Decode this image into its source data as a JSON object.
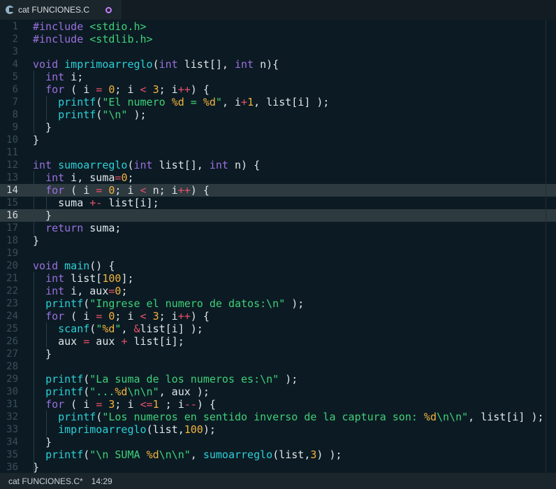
{
  "tab": {
    "title": "cat FUNCIONES.C",
    "icon": "c-file-icon",
    "dirty": true
  },
  "status": {
    "file": "cat FUNCIONES.C*",
    "position": "14:29"
  },
  "editor": {
    "highlight_lines": [
      14,
      16
    ],
    "lines": [
      [
        [
          "pp",
          "#include "
        ],
        [
          "st",
          "<stdio.h>"
        ]
      ],
      [
        [
          "pp",
          "#include "
        ],
        [
          "st",
          "<stdlib.h>"
        ]
      ],
      [],
      [
        [
          "ty",
          "void "
        ],
        [
          "fn",
          "imprimoarreglo"
        ],
        [
          "pl",
          "("
        ],
        [
          "ty",
          "int"
        ],
        [
          "pl",
          " list[], "
        ],
        [
          "ty",
          "int"
        ],
        [
          "pl",
          " n){"
        ]
      ],
      [
        [
          "pl",
          "  "
        ],
        [
          "ty",
          "int"
        ],
        [
          "pl",
          " i;"
        ]
      ],
      [
        [
          "pl",
          "  "
        ],
        [
          "kw",
          "for"
        ],
        [
          "pl",
          " ( i "
        ],
        [
          "op",
          "="
        ],
        [
          "pl",
          " "
        ],
        [
          "nu",
          "0"
        ],
        [
          "pl",
          "; i "
        ],
        [
          "op",
          "<"
        ],
        [
          "pl",
          " "
        ],
        [
          "nu",
          "3"
        ],
        [
          "pl",
          "; i"
        ],
        [
          "op",
          "++"
        ],
        [
          "pl",
          ") {"
        ]
      ],
      [
        [
          "pl",
          "    "
        ],
        [
          "fn",
          "printf"
        ],
        [
          "pl",
          "("
        ],
        [
          "st",
          "\"El numero "
        ],
        [
          "fm",
          "%d"
        ],
        [
          "st",
          " = "
        ],
        [
          "fm",
          "%d"
        ],
        [
          "st",
          "\""
        ],
        [
          "pl",
          ", i"
        ],
        [
          "op",
          "+"
        ],
        [
          "nu",
          "1"
        ],
        [
          "pl",
          ", list[i] );"
        ]
      ],
      [
        [
          "pl",
          "    "
        ],
        [
          "fn",
          "printf"
        ],
        [
          "pl",
          "("
        ],
        [
          "st",
          "\"\\n\""
        ],
        [
          "pl",
          " );"
        ]
      ],
      [
        [
          "pl",
          "  }"
        ]
      ],
      [
        [
          "pl",
          "}"
        ]
      ],
      [],
      [
        [
          "ty",
          "int "
        ],
        [
          "fn",
          "sumoarreglo"
        ],
        [
          "pl",
          "("
        ],
        [
          "ty",
          "int"
        ],
        [
          "pl",
          " list[], "
        ],
        [
          "ty",
          "int"
        ],
        [
          "pl",
          " n) {"
        ]
      ],
      [
        [
          "pl",
          "  "
        ],
        [
          "ty",
          "int"
        ],
        [
          "pl",
          " i, suma"
        ],
        [
          "op",
          "="
        ],
        [
          "nu",
          "0"
        ],
        [
          "pl",
          ";"
        ]
      ],
      [
        [
          "pl",
          "  "
        ],
        [
          "kw",
          "for"
        ],
        [
          "pl",
          " ( i "
        ],
        [
          "op",
          "="
        ],
        [
          "pl",
          " "
        ],
        [
          "nu",
          "0"
        ],
        [
          "pl",
          "; i "
        ],
        [
          "op",
          "<"
        ],
        [
          "pl",
          " n; i"
        ],
        [
          "op",
          "++"
        ],
        [
          "pl",
          ") {"
        ]
      ],
      [
        [
          "pl",
          "    suma "
        ],
        [
          "op",
          "+-"
        ],
        [
          "pl",
          " list[i];"
        ]
      ],
      [
        [
          "pl",
          "  }"
        ]
      ],
      [
        [
          "pl",
          "  "
        ],
        [
          "kw",
          "return"
        ],
        [
          "pl",
          " suma;"
        ]
      ],
      [
        [
          "pl",
          "}"
        ]
      ],
      [],
      [
        [
          "ty",
          "void "
        ],
        [
          "fn",
          "main"
        ],
        [
          "pl",
          "() {"
        ]
      ],
      [
        [
          "pl",
          "  "
        ],
        [
          "ty",
          "int"
        ],
        [
          "pl",
          " list["
        ],
        [
          "nu",
          "100"
        ],
        [
          "pl",
          "];"
        ]
      ],
      [
        [
          "pl",
          "  "
        ],
        [
          "ty",
          "int"
        ],
        [
          "pl",
          " i, aux"
        ],
        [
          "op",
          "="
        ],
        [
          "nu",
          "0"
        ],
        [
          "pl",
          ";"
        ]
      ],
      [
        [
          "pl",
          "  "
        ],
        [
          "fn",
          "printf"
        ],
        [
          "pl",
          "("
        ],
        [
          "st",
          "\"Ingrese el numero de datos:\\n\""
        ],
        [
          "pl",
          " );"
        ]
      ],
      [
        [
          "pl",
          "  "
        ],
        [
          "kw",
          "for"
        ],
        [
          "pl",
          " ( i "
        ],
        [
          "op",
          "="
        ],
        [
          "pl",
          " "
        ],
        [
          "nu",
          "0"
        ],
        [
          "pl",
          "; i "
        ],
        [
          "op",
          "<"
        ],
        [
          "pl",
          " "
        ],
        [
          "nu",
          "3"
        ],
        [
          "pl",
          "; i"
        ],
        [
          "op",
          "++"
        ],
        [
          "pl",
          ") {"
        ]
      ],
      [
        [
          "pl",
          "    "
        ],
        [
          "fn",
          "scanf"
        ],
        [
          "pl",
          "("
        ],
        [
          "st",
          "\""
        ],
        [
          "fm",
          "%d"
        ],
        [
          "st",
          "\""
        ],
        [
          "pl",
          ", "
        ],
        [
          "op",
          "&"
        ],
        [
          "pl",
          "list[i] );"
        ]
      ],
      [
        [
          "pl",
          "    aux "
        ],
        [
          "op",
          "="
        ],
        [
          "pl",
          " aux "
        ],
        [
          "op",
          "+"
        ],
        [
          "pl",
          " list[i];"
        ]
      ],
      [
        [
          "pl",
          "  }"
        ]
      ],
      [],
      [
        [
          "pl",
          "  "
        ],
        [
          "fn",
          "printf"
        ],
        [
          "pl",
          "("
        ],
        [
          "st",
          "\"La suma de los numeros es:\\n\""
        ],
        [
          "pl",
          " );"
        ]
      ],
      [
        [
          "pl",
          "  "
        ],
        [
          "fn",
          "printf"
        ],
        [
          "pl",
          "("
        ],
        [
          "st",
          "\"..."
        ],
        [
          "fm",
          "%d"
        ],
        [
          "st",
          "\\n\\n\""
        ],
        [
          "pl",
          ", aux );"
        ]
      ],
      [
        [
          "pl",
          "  "
        ],
        [
          "kw",
          "for"
        ],
        [
          "pl",
          " ( i "
        ],
        [
          "op",
          "="
        ],
        [
          "pl",
          " "
        ],
        [
          "nu",
          "3"
        ],
        [
          "pl",
          "; i "
        ],
        [
          "op",
          "<="
        ],
        [
          "nu",
          "1"
        ],
        [
          "pl",
          " ; i"
        ],
        [
          "op",
          "--"
        ],
        [
          "pl",
          ") {"
        ]
      ],
      [
        [
          "pl",
          "    "
        ],
        [
          "fn",
          "printf"
        ],
        [
          "pl",
          "("
        ],
        [
          "st",
          "\"Los numeros en sentido inverso de la captura son: "
        ],
        [
          "fm",
          "%d"
        ],
        [
          "st",
          "\\n\\n\""
        ],
        [
          "pl",
          ", list[i] );"
        ]
      ],
      [
        [
          "pl",
          "    "
        ],
        [
          "fn",
          "imprimoarreglo"
        ],
        [
          "pl",
          "(list,"
        ],
        [
          "nu",
          "100"
        ],
        [
          "pl",
          ");"
        ]
      ],
      [
        [
          "pl",
          "  }"
        ]
      ],
      [
        [
          "pl",
          "  "
        ],
        [
          "fn",
          "printf"
        ],
        [
          "pl",
          "("
        ],
        [
          "st",
          "\"\\n SUMA "
        ],
        [
          "fm",
          "%d"
        ],
        [
          "st",
          "\\n\\n\""
        ],
        [
          "pl",
          ", "
        ],
        [
          "fn",
          "sumoarreglo"
        ],
        [
          "pl",
          "(list,"
        ],
        [
          "nu",
          "3"
        ],
        [
          "pl",
          ") );"
        ]
      ],
      [
        [
          "pl",
          "}"
        ]
      ]
    ]
  }
}
